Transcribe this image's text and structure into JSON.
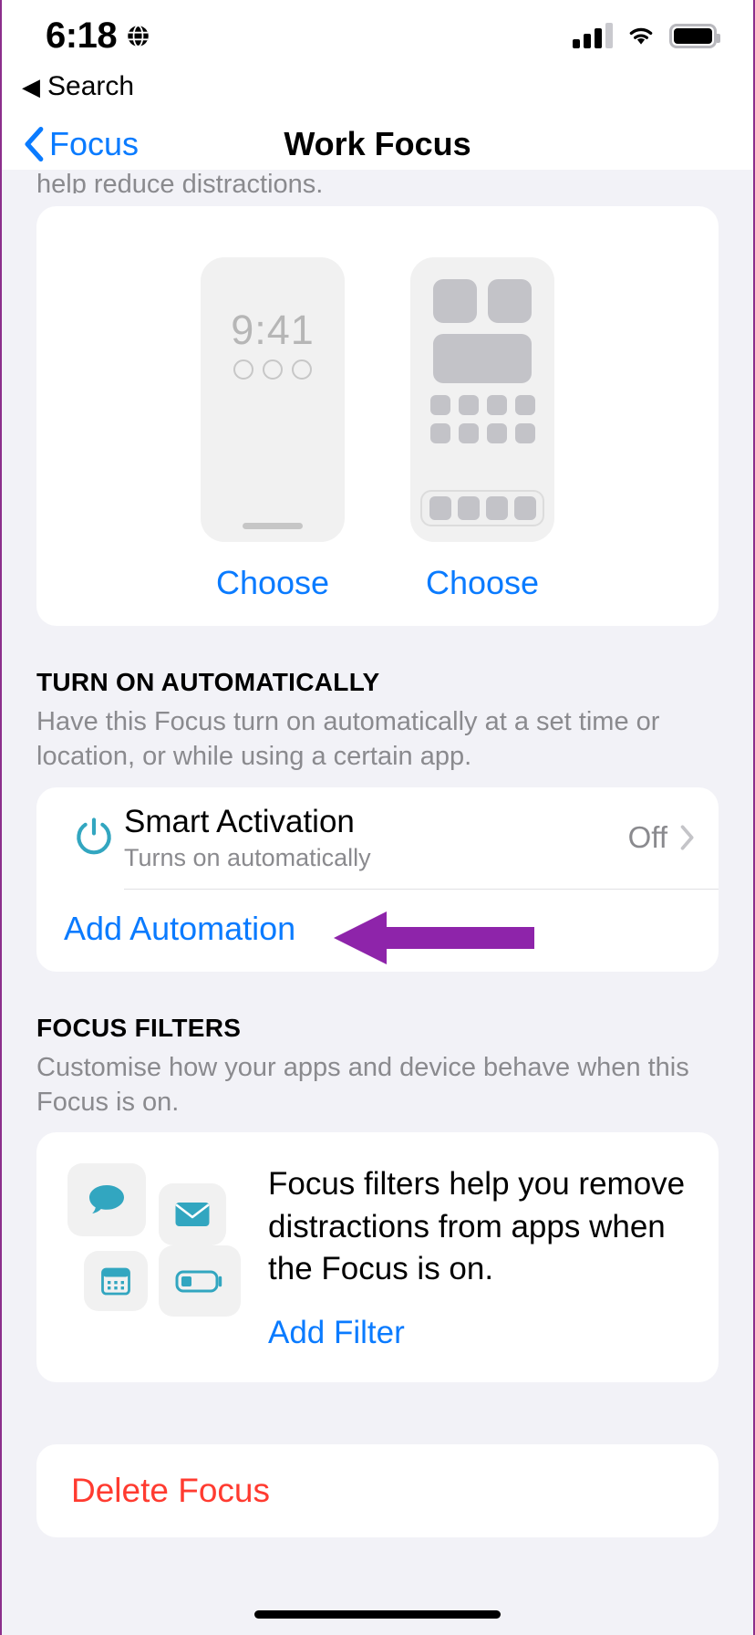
{
  "status_bar": {
    "time": "6:18",
    "globe_icon": "globe-icon",
    "signal_icon": "cellular-signal-icon",
    "wifi_icon": "wifi-icon",
    "battery_icon": "battery-full-icon"
  },
  "search_back": {
    "caret": "◀",
    "label": "Search"
  },
  "nav": {
    "back_label": "Focus",
    "title": "Work Focus"
  },
  "clipped_text": "help reduce distractions.",
  "screens_card": {
    "lock_screen": {
      "time": "9:41",
      "choose_label": "Choose"
    },
    "home_screen": {
      "choose_label": "Choose"
    }
  },
  "turn_on_automatically": {
    "header": "TURN ON AUTOMATICALLY",
    "description": "Have this Focus turn on automatically at a set time or location, or while using a certain app.",
    "rows": [
      {
        "icon": "power-icon",
        "title": "Smart Activation",
        "subtitle": "Turns on automatically",
        "value": "Off",
        "accessory": "chevron-right-icon"
      }
    ],
    "add_automation_label": "Add Automation",
    "annotation": {
      "type": "arrow-left",
      "color": "#8e24aa"
    }
  },
  "focus_filters": {
    "header": "FOCUS FILTERS",
    "description": "Customise how your apps and device behave when this Focus is on.",
    "body": "Focus filters help you remove distractions from apps when the Focus is on.",
    "add_filter_label": "Add Filter",
    "icons": [
      "messages-bubble-icon",
      "mail-envelope-icon",
      "calendar-icon",
      "battery-low-power-icon"
    ]
  },
  "delete": {
    "label": "Delete Focus"
  },
  "colors": {
    "accent_blue": "#0a7bff",
    "destructive_red": "#ff3b30",
    "icon_teal": "#32a6c0",
    "annotation_purple": "#8e24aa",
    "group_background": "#f2f2f7"
  }
}
